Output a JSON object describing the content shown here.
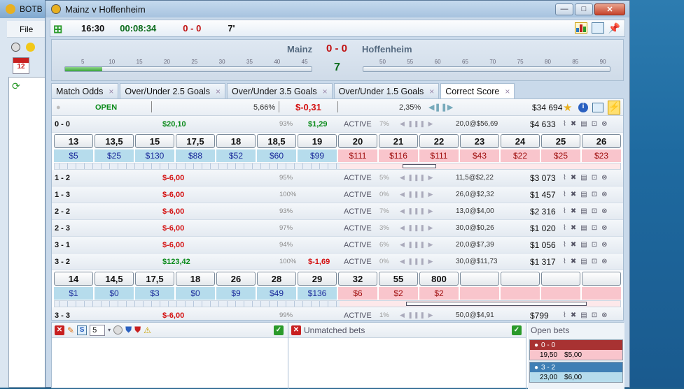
{
  "background_app": {
    "title": "BOTB",
    "menu_file": "File",
    "badge": "12"
  },
  "window": {
    "title": "Mainz v Hoffenheim"
  },
  "toolbar": {
    "kickoff": "16:30",
    "elapsed": "00:08:34",
    "score": "0 - 0",
    "minute": "7'"
  },
  "scoreboard": {
    "home": "Mainz",
    "score": "0 - 0",
    "away": "Hoffenheim",
    "minute": "7",
    "first_half_ticks": [
      "5",
      "10",
      "15",
      "20",
      "25",
      "30",
      "35",
      "40",
      "45"
    ],
    "second_half_ticks": [
      "50",
      "55",
      "60",
      "65",
      "70",
      "75",
      "80",
      "85",
      "90"
    ],
    "first_half_progress": 0.15
  },
  "tabs": [
    {
      "label": "Match Odds"
    },
    {
      "label": "Over/Under 2.5 Goals"
    },
    {
      "label": "Over/Under 3.5 Goals"
    },
    {
      "label": "Over/Under 1.5 Goals"
    },
    {
      "label": "Correct Score",
      "active": true
    }
  ],
  "market_header": {
    "status": "OPEN",
    "back_pct": "5,66%",
    "pl": "$-0,31",
    "lay_pct": "2,35%",
    "matched": "$34 694"
  },
  "rows_top": [
    {
      "sel": "0 - 0",
      "pl": "$20,10",
      "pl_color": "green",
      "pct": "93%",
      "pl2": "$1,29",
      "pl2_color": "green",
      "status": "ACTIVE",
      "pct2": "7%",
      "odds": "20,0@$56,69",
      "vol": "$4 633"
    }
  ],
  "ladder1": {
    "prices": [
      "13",
      "13,5",
      "15",
      "17,5",
      "18",
      "18,5",
      "19",
      "20",
      "21",
      "22",
      "23",
      "24",
      "25",
      "26"
    ],
    "amounts": [
      "$5",
      "$25",
      "$130",
      "$88",
      "$52",
      "$60",
      "$99",
      "$111",
      "$116",
      "$111",
      "$43",
      "$22",
      "$25",
      "$23"
    ]
  },
  "rows_mid": [
    {
      "sel": "1 - 2",
      "pl": "$-6,00",
      "pct": "95%",
      "status": "ACTIVE",
      "pct2": "5%",
      "odds": "11,5@$2,22",
      "vol": "$3 073"
    },
    {
      "sel": "1 - 3",
      "pl": "$-6,00",
      "pct": "100%",
      "status": "ACTIVE",
      "pct2": "0%",
      "odds": "26,0@$2,32",
      "vol": "$1 457"
    },
    {
      "sel": "2 - 2",
      "pl": "$-6,00",
      "pct": "93%",
      "status": "ACTIVE",
      "pct2": "7%",
      "odds": "13,0@$4,00",
      "vol": "$2 316"
    },
    {
      "sel": "2 - 3",
      "pl": "$-6,00",
      "pct": "97%",
      "status": "ACTIVE",
      "pct2": "3%",
      "odds": "30,0@$0,26",
      "vol": "$1 020"
    },
    {
      "sel": "3 - 1",
      "pl": "$-6,00",
      "pct": "94%",
      "status": "ACTIVE",
      "pct2": "6%",
      "odds": "20,0@$7,39",
      "vol": "$1 056"
    },
    {
      "sel": "3 - 2",
      "pl": "$123,42",
      "pl_color": "green",
      "pct": "100%",
      "pl2": "$-1,69",
      "status": "ACTIVE",
      "pct2": "0%",
      "odds": "30,0@$11,73",
      "vol": "$1 317"
    }
  ],
  "ladder2": {
    "prices": [
      "14",
      "14,5",
      "17,5",
      "18",
      "26",
      "28",
      "29",
      "32",
      "55",
      "800",
      "",
      "",
      "",
      ""
    ],
    "amounts": [
      "$1",
      "$0",
      "$3",
      "$0",
      "$9",
      "$49",
      "$136",
      "$6",
      "$2",
      "$2",
      "",
      "",
      "",
      ""
    ]
  },
  "rows_bottom": [
    {
      "sel": "3 - 3",
      "pl": "$-6,00",
      "pct": "99%",
      "status": "ACTIVE",
      "pct2": "1%",
      "odds": "50,0@$4,91",
      "vol": "$799"
    }
  ],
  "bottom": {
    "stake_value": "5",
    "unmatched_title": "Unmatched bets",
    "open_title": "Open bets",
    "open_bets": [
      {
        "sel": "0 - 0",
        "odds": "19,50",
        "stake": "$5,00",
        "color": "#a83232",
        "body_bg": "#f9c5cc"
      },
      {
        "sel": "3 - 2",
        "odds": "23,00",
        "stake": "$6,00",
        "color": "#3f7fb5",
        "body_bg": "#b6dcec"
      }
    ]
  },
  "colors": {
    "back": "#b6dcec",
    "lay": "#f9c5cc",
    "green": "#0a8a1a",
    "red": "#d41010"
  }
}
